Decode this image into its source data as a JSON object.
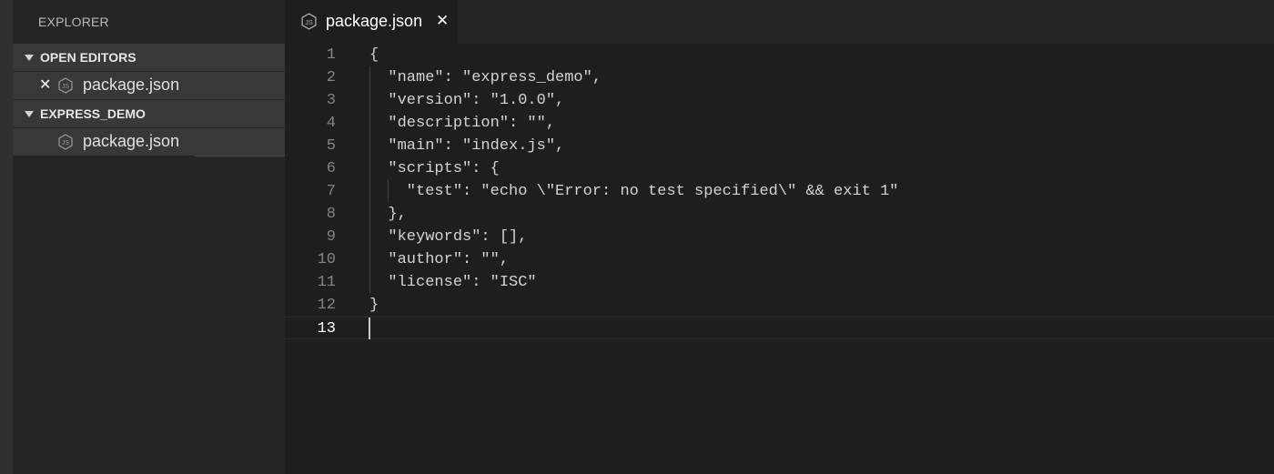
{
  "sidebar": {
    "title": "EXPLORER",
    "open_editors": {
      "header": "OPEN EDITORS",
      "files": [
        {
          "name": "package.json"
        }
      ]
    },
    "project": {
      "header": "EXPRESS_DEMO",
      "files": [
        {
          "name": "package.json"
        }
      ]
    }
  },
  "tabs": [
    {
      "label": "package.json",
      "close": "✕"
    }
  ],
  "icons": {
    "file": "js-file-icon",
    "close": "close-icon",
    "collapse": "chevron-down-icon"
  },
  "editor": {
    "lines": [
      {
        "n": "1",
        "text": "{"
      },
      {
        "n": "2",
        "text": "  \"name\": \"express_demo\","
      },
      {
        "n": "3",
        "text": "  \"version\": \"1.0.0\","
      },
      {
        "n": "4",
        "text": "  \"description\": \"\","
      },
      {
        "n": "5",
        "text": "  \"main\": \"index.js\","
      },
      {
        "n": "6",
        "text": "  \"scripts\": {"
      },
      {
        "n": "7",
        "text": "    \"test\": \"echo \\\"Error: no test specified\\\" && exit 1\""
      },
      {
        "n": "8",
        "text": "  },"
      },
      {
        "n": "9",
        "text": "  \"keywords\": [],"
      },
      {
        "n": "10",
        "text": "  \"author\": \"\","
      },
      {
        "n": "11",
        "text": "  \"license\": \"ISC\""
      },
      {
        "n": "12",
        "text": "}"
      },
      {
        "n": "13",
        "text": ""
      }
    ],
    "current_line": "13"
  },
  "colors": {
    "editor_bg": "#1e1e1e",
    "sidebar_bg": "#252526",
    "selection_bg": "#383838",
    "line_number": "#858585"
  }
}
